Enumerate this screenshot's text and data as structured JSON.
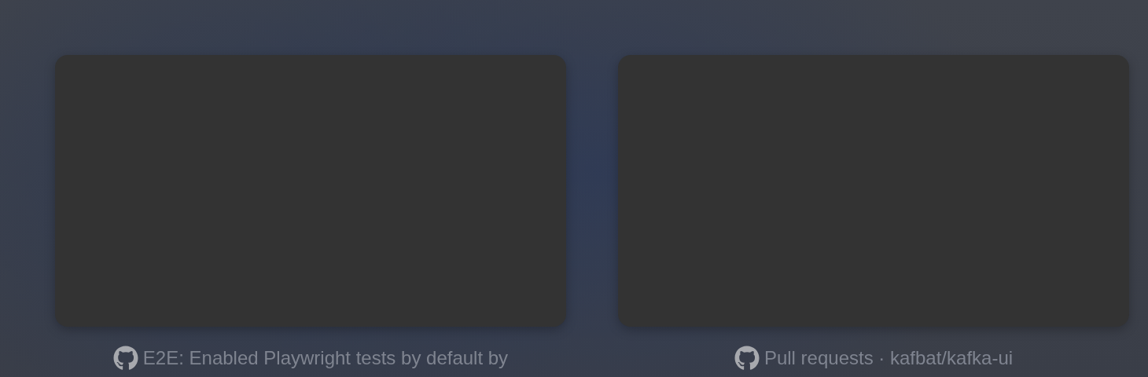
{
  "windows": [
    {
      "title": "E2E: Enabled Playwright tests by default by"
    },
    {
      "title": "Pull requests · kafbat/kafka-ui"
    }
  ]
}
